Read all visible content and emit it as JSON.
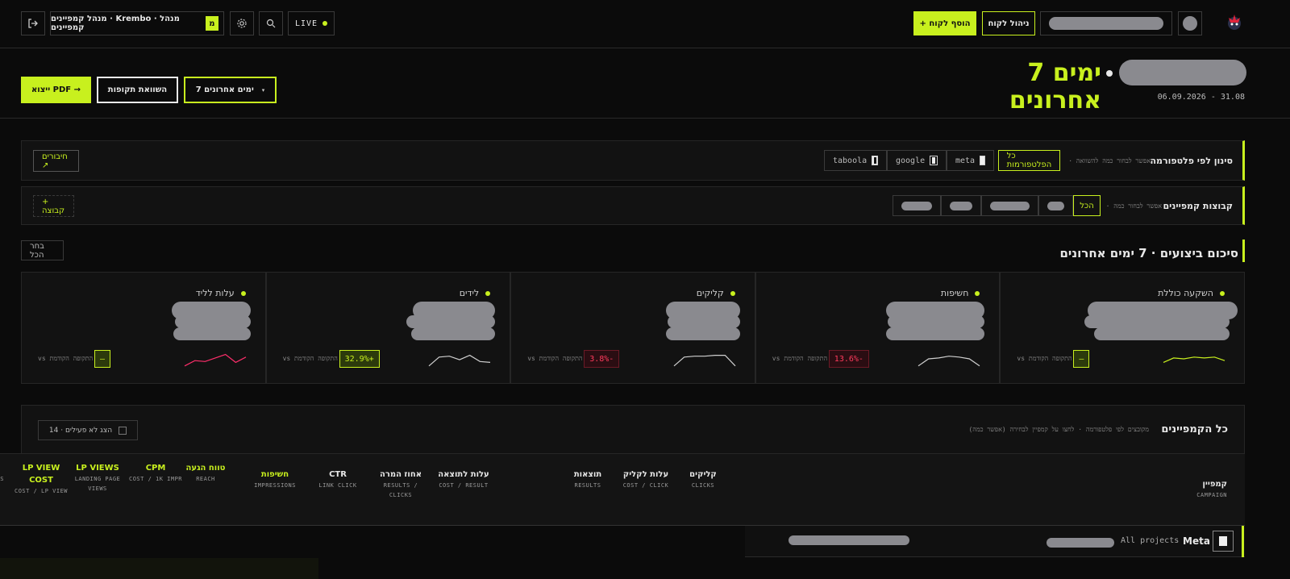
{
  "topbar": {
    "live_label": "LIVE",
    "app_title": "מנהל קמפיינים · Krembo · מנהל קמפיינים",
    "badge_letter": "מ",
    "manage_client_label": "ניהול לקוח",
    "add_client_label": "+ הוסף לקוח"
  },
  "header": {
    "title": "7 ימים אחרונים",
    "date_range": "06.09.2026 - 31.08",
    "range_button": "7 ימים אחרונים",
    "compare_button": "השוואת תקופות",
    "export_button": "ייצוא PDF →"
  },
  "platform_filter": {
    "title": "סינון לפי פלטפורמה",
    "hint": "· אפשר לבחור כמה להשוואה",
    "chips": [
      {
        "label": "כל הפלטפורמות",
        "active": true
      },
      {
        "label": "meta"
      },
      {
        "label": "google"
      },
      {
        "label": "taboola"
      }
    ],
    "connections_label": "חיבורים ↗"
  },
  "groups": {
    "title": "קבוצות קמפיינים",
    "hint": "· אפשר לבחור כמה",
    "all_label": "הכל",
    "add_group_label": "+ קבוצה"
  },
  "summary": {
    "title": "סיכום ביצועים · 7 ימים אחרונים",
    "select_all": "בחר הכל",
    "vs_label": "vs התקופה הקודמת",
    "cards": [
      {
        "label": "השקעה כוללת",
        "delta": "—",
        "tone": "neutral",
        "spark": [
          0.3,
          0.55,
          0.5,
          0.6,
          0.55,
          0.6,
          0.4
        ],
        "color": "#c8f01e"
      },
      {
        "label": "חשיפות",
        "delta": "13.6%-",
        "tone": "down",
        "spark": [
          0.1,
          0.5,
          0.55,
          0.65,
          0.6,
          0.5,
          0.1
        ],
        "color": "#cfcfcf"
      },
      {
        "label": "קליקים",
        "delta": "3.8%-",
        "tone": "down",
        "spark": [
          0.1,
          0.6,
          0.65,
          0.65,
          0.7,
          0.7,
          0.1
        ],
        "color": "#cfcfcf"
      },
      {
        "label": "לידים",
        "delta": "32.9%+",
        "tone": "up",
        "spark": [
          0.1,
          0.6,
          0.65,
          0.45,
          0.7,
          0.35,
          0.3
        ],
        "color": "#cfcfcf"
      },
      {
        "label": "עלות לליד",
        "delta": "—",
        "tone": "neutral",
        "spark": [
          0.1,
          0.4,
          0.35,
          0.55,
          0.75,
          0.3,
          0.6
        ],
        "color": "#ff2e6b"
      }
    ]
  },
  "campaigns": {
    "title": "כל הקמפיינים",
    "hint": "מקובצים לפי פלטפורמה · לחצו על קמפיין לבחירה (אפשר כמה)",
    "inactive_label": "הצג לא פעילים · 14",
    "columns": [
      {
        "main": "קמפיין",
        "sub": "CAMPAIGN"
      },
      {
        "main": "קליקים",
        "sub": "CLICKS"
      },
      {
        "main": "עלות לקליק",
        "sub": "COST / CLICK"
      },
      {
        "main": "תוצאות",
        "sub": "RESULTS"
      },
      {
        "main": "עלות לתוצאה",
        "sub": "COST / RESULT"
      },
      {
        "main": "אחוז המרה",
        "sub": "RESULTS / CLICKS"
      },
      {
        "main": "CTR",
        "sub": "LINK CLICK"
      },
      {
        "main": "חשיפות",
        "sub": "IMPRESSIONS"
      },
      {
        "main": "טווח הגעה",
        "sub": "REACH"
      },
      {
        "main": "CPM",
        "sub": "COST / 1K IMPR"
      },
      {
        "main": "LP VIEWS",
        "sub": "LANDING PAGE VIEWS"
      },
      {
        "main": "LP VIEW COST",
        "sub": "COST / LP VIEW"
      },
      {
        "main": "LP",
        "sub": "LTS LP IEWS"
      }
    ],
    "meta_row": {
      "platform": "Meta",
      "projects": "All projects"
    }
  }
}
